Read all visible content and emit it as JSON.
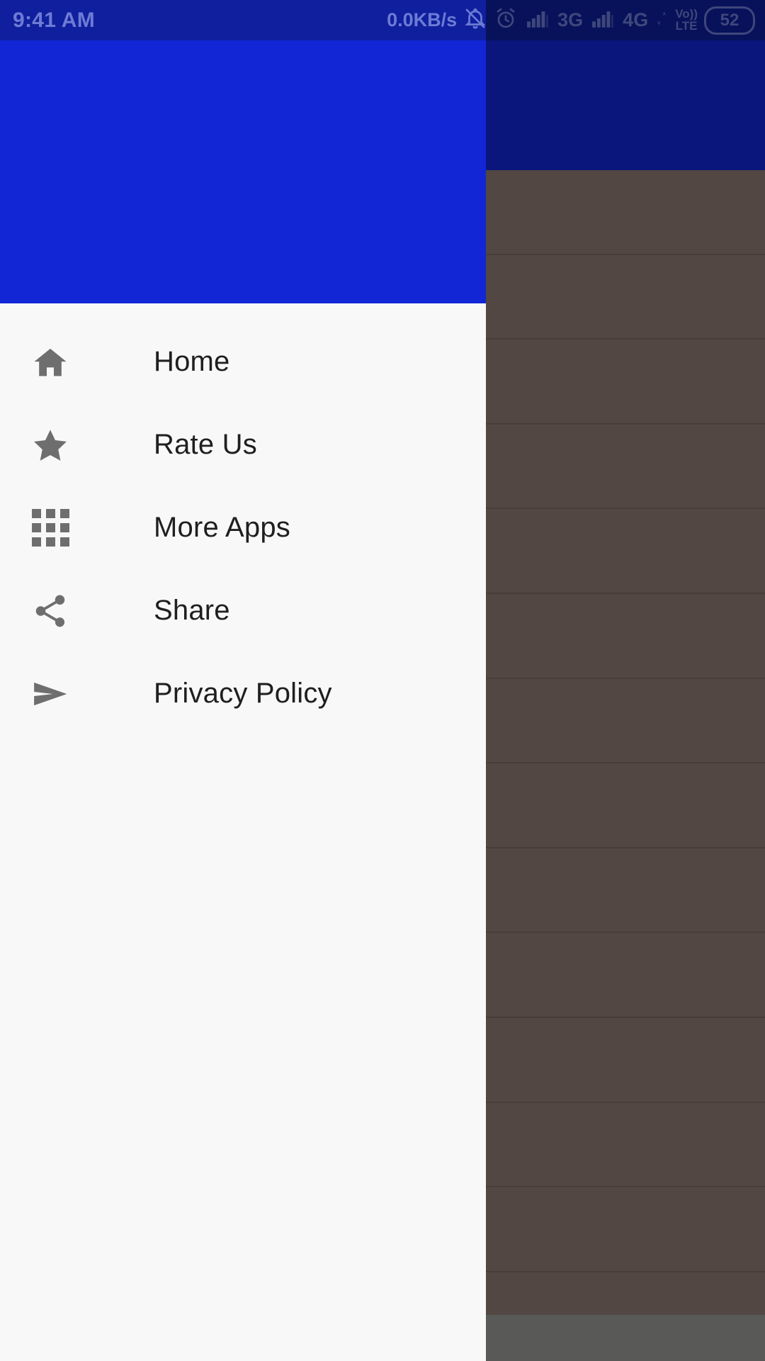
{
  "status_bar": {
    "clock": "9:41 AM",
    "network_speed": "0.0KB/s",
    "notifications_muted_icon": "bell-off-icon",
    "alarm_icon": "alarm-clock-icon",
    "signal1_icon": "signal-bars-icon",
    "network_type_1": "3G",
    "signal2_icon": "signal-bars-icon",
    "network_type_2": "4G",
    "data_arrows_icon": "data-transfer-icon",
    "volte_top": "Vo))",
    "volte_bottom": "LTE",
    "battery_level": "52",
    "text_color": "#6d7bd4",
    "background_color": "#0f1f9e"
  },
  "drawer": {
    "header_color": "#1226d6",
    "background_color": "#f8f8f9",
    "icon_color": "#6e6e6e",
    "label_color": "#1f1f1f",
    "items": [
      {
        "label": "Home",
        "icon": "home-icon"
      },
      {
        "label": "Rate Us",
        "icon": "star-icon"
      },
      {
        "label": "More Apps",
        "icon": "grid-apps-icon"
      },
      {
        "label": "Share",
        "icon": "share-icon"
      },
      {
        "label": "Privacy Policy",
        "icon": "send-icon"
      }
    ]
  },
  "background_app": {
    "toolbar_color": "#1226d6",
    "list_color": "#8d7a72",
    "bottom_bar_color": "#9a9a97",
    "scrim_color": "rgba(0,0,0,0.42)",
    "row_count": 14
  }
}
